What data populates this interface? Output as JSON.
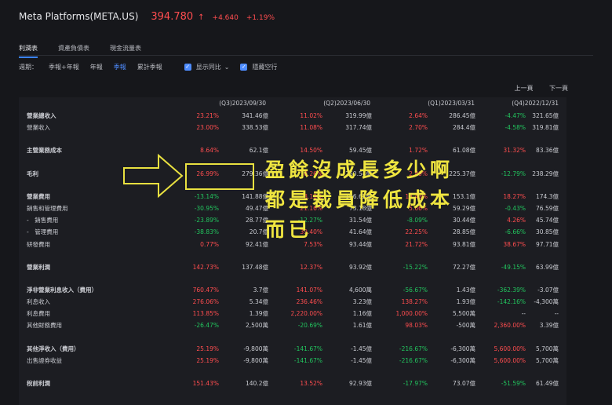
{
  "header": {
    "title": "Meta Platforms(META.US)",
    "price": "394.780",
    "arrow": "↑",
    "change": "+4.640",
    "change_pct": "+1.19%"
  },
  "tabs": [
    "利潤表",
    "資產負債表",
    "現金流量表"
  ],
  "filters": {
    "period_label": "週期：",
    "options": [
      "季報+年報",
      "年報",
      "季報",
      "累計季報"
    ],
    "selected": "季報",
    "yoy_label": "显示同比",
    "hide_empty_label": "隱藏空行"
  },
  "pager": {
    "prev": "上一頁",
    "next": "下一頁"
  },
  "columns": [
    "(Q3)2023/09/30",
    "(Q2)2023/06/30",
    "(Q1)2023/03/31",
    "(Q4)2022/12/31"
  ],
  "rows": [
    {
      "label": "營業總收入",
      "bold": true,
      "cells": [
        [
          "23.21%",
          "up",
          "341.46億"
        ],
        [
          "11.02%",
          "up",
          "319.99億"
        ],
        [
          "2.64%",
          "up",
          "286.45億"
        ],
        [
          "-4.47%",
          "dn",
          "321.65億"
        ]
      ]
    },
    {
      "label": "營業收入",
      "cells": [
        [
          "23.00%",
          "up",
          "338.53億"
        ],
        [
          "11.08%",
          "up",
          "317.74億"
        ],
        [
          "2.70%",
          "up",
          "284.4億"
        ],
        [
          "-4.58%",
          "dn",
          "319.81億"
        ]
      ]
    },
    {
      "gap": true
    },
    {
      "label": "主營業務成本",
      "bold": true,
      "cells": [
        [
          "8.64%",
          "up",
          "62.1億"
        ],
        [
          "14.50%",
          "up",
          "59.45億"
        ],
        [
          "1.72%",
          "up",
          "61.08億"
        ],
        [
          "31.32%",
          "up",
          "83.36億"
        ]
      ]
    },
    {
      "gap": true
    },
    {
      "label": "毛利",
      "bold": true,
      "cells": [
        [
          "26.99%",
          "up",
          "279.36億"
        ],
        [
          "10.26%",
          "up",
          "260.54億"
        ],
        [
          "2.89%",
          "up",
          "225.37億"
        ],
        [
          "-12.79%",
          "dn",
          "238.29億"
        ]
      ]
    },
    {
      "gap": true
    },
    {
      "label": "營業費用",
      "bold": true,
      "cells": [
        [
          "-13.14%",
          "dn",
          "141.88億"
        ],
        [
          "8.10%",
          "up",
          "166.62億"
        ],
        [
          "14.43%",
          "up",
          "153.1億"
        ],
        [
          "18.27%",
          "up",
          "174.3億"
        ]
      ]
    },
    {
      "label": "銷售和管理費用",
      "cells": [
        [
          "-30.95%",
          "dn",
          "49.47億"
        ],
        [
          "21.16%",
          "up",
          "73.18億"
        ],
        [
          "5.66%",
          "up",
          "59.29億"
        ],
        [
          "-0.43%",
          "dn",
          "76.59億"
        ]
      ]
    },
    {
      "label": "-　銷售費用",
      "cells": [
        [
          "-23.89%",
          "dn",
          "28.77億"
        ],
        [
          "-12.27%",
          "dn",
          "31.54億"
        ],
        [
          "-8.09%",
          "dn",
          "30.44億"
        ],
        [
          "4.26%",
          "up",
          "45.74億"
        ]
      ]
    },
    {
      "label": "-　管理費用",
      "cells": [
        [
          "-38.83%",
          "dn",
          "20.7億"
        ],
        [
          "39.40%",
          "up",
          "41.64億"
        ],
        [
          "22.25%",
          "up",
          "28.85億"
        ],
        [
          "-6.66%",
          "dn",
          "30.85億"
        ]
      ]
    },
    {
      "label": "研發費用",
      "cells": [
        [
          "0.77%",
          "up",
          "92.41億"
        ],
        [
          "7.53%",
          "up",
          "93.44億"
        ],
        [
          "21.72%",
          "up",
          "93.81億"
        ],
        [
          "38.67%",
          "up",
          "97.71億"
        ]
      ]
    },
    {
      "gap": true
    },
    {
      "label": "營業利潤",
      "bold": true,
      "cells": [
        [
          "142.73%",
          "up",
          "137.48億"
        ],
        [
          "12.37%",
          "up",
          "93.92億"
        ],
        [
          "-15.22%",
          "dn",
          "72.27億"
        ],
        [
          "-49.15%",
          "dn",
          "63.99億"
        ]
      ]
    },
    {
      "gap": true
    },
    {
      "label": "淨非營業利息收入（費用）",
      "bold": true,
      "cells": [
        [
          "760.47%",
          "up",
          "3.7億"
        ],
        [
          "141.07%",
          "up",
          "4,600萬"
        ],
        [
          "-56.67%",
          "dn",
          "1.43億"
        ],
        [
          "-362.39%",
          "dn",
          "-3.07億"
        ]
      ]
    },
    {
      "label": "利息收入",
      "cells": [
        [
          "276.06%",
          "up",
          "5.34億"
        ],
        [
          "236.46%",
          "up",
          "3.23億"
        ],
        [
          "138.27%",
          "up",
          "1.93億"
        ],
        [
          "-142.16%",
          "dn",
          "-4,300萬"
        ]
      ]
    },
    {
      "label": "利息費用",
      "cells": [
        [
          "113.85%",
          "up",
          "1.39億"
        ],
        [
          "2,220.00%",
          "up",
          "1.16億"
        ],
        [
          "1,000.00%",
          "up",
          "5,500萬"
        ],
        [
          "--",
          "none",
          "--"
        ]
      ]
    },
    {
      "label": "其他財務費用",
      "cells": [
        [
          "-26.47%",
          "dn",
          "2,500萬"
        ],
        [
          "-20.69%",
          "dn",
          "1.61億"
        ],
        [
          "98.03%",
          "up",
          "-500萬"
        ],
        [
          "2,360.00%",
          "up",
          "3.39億"
        ]
      ]
    },
    {
      "gap": true
    },
    {
      "label": "其他淨收入（費用）",
      "bold": true,
      "cells": [
        [
          "25.19%",
          "up",
          "-9,800萬"
        ],
        [
          "-141.67%",
          "dn",
          "-1.45億"
        ],
        [
          "-216.67%",
          "dn",
          "-6,300萬"
        ],
        [
          "5,600.00%",
          "up",
          "5,700萬"
        ]
      ]
    },
    {
      "label": "出售證券收益",
      "cells": [
        [
          "25.19%",
          "up",
          "-9,800萬"
        ],
        [
          "-141.67%",
          "dn",
          "-1.45億"
        ],
        [
          "-216.67%",
          "dn",
          "-6,300萬"
        ],
        [
          "5,600.00%",
          "up",
          "5,700萬"
        ]
      ]
    },
    {
      "gap": true
    },
    {
      "label": "稅前利潤",
      "bold": true,
      "cells": [
        [
          "151.43%",
          "up",
          "140.2億"
        ],
        [
          "13.52%",
          "up",
          "92.93億"
        ],
        [
          "-17.97%",
          "dn",
          "73.07億"
        ],
        [
          "-51.59%",
          "dn",
          "61.49億"
        ]
      ]
    }
  ],
  "annotation": {
    "text": "盈餘沒成長多少啊\n都是裁員降低成本\n而已"
  }
}
